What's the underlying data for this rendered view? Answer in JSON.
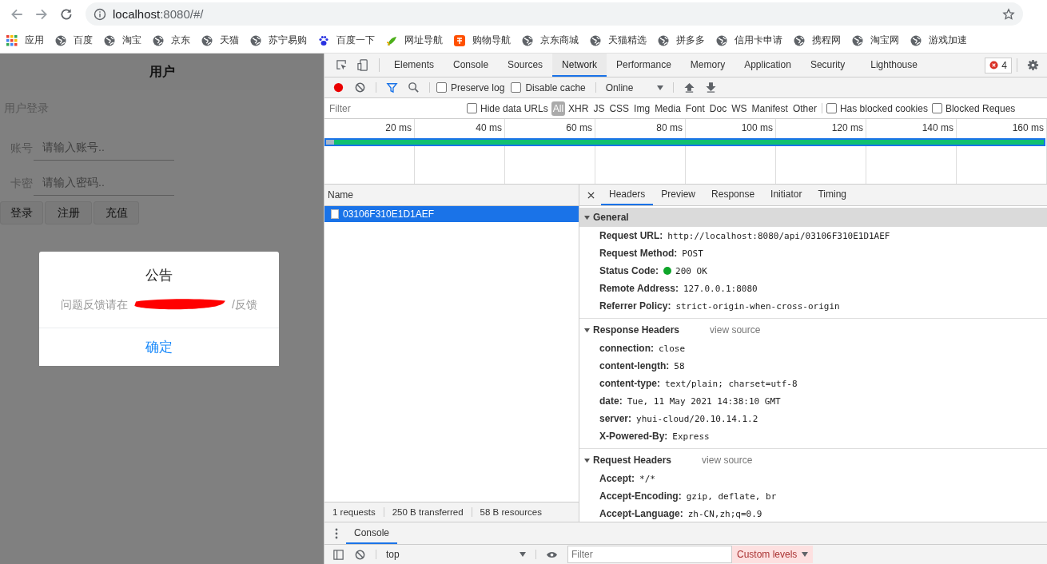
{
  "browser": {
    "url_host": "localhost",
    "url_rest": ":8080/#/"
  },
  "bookmarks": [
    {
      "label": "应用",
      "kind": "apps"
    },
    {
      "label": "百度",
      "kind": "globe"
    },
    {
      "label": "淘宝",
      "kind": "globe"
    },
    {
      "label": "京东",
      "kind": "globe"
    },
    {
      "label": "天猫",
      "kind": "globe"
    },
    {
      "label": "苏宁易购",
      "kind": "globe"
    },
    {
      "label": "百度一下",
      "kind": "paw"
    },
    {
      "label": "网址导航",
      "kind": "leaf"
    },
    {
      "label": "购物导航",
      "kind": "tao"
    },
    {
      "label": "京东商城",
      "kind": "globe"
    },
    {
      "label": "天猫精选",
      "kind": "globe"
    },
    {
      "label": "拼多多",
      "kind": "globe"
    },
    {
      "label": "信用卡申请",
      "kind": "globe"
    },
    {
      "label": "携程网",
      "kind": "globe"
    },
    {
      "label": "淘宝网",
      "kind": "globe"
    },
    {
      "label": "游戏加速",
      "kind": "globe"
    }
  ],
  "page": {
    "header": "用户",
    "section_title": "用户登录",
    "fields": [
      {
        "label": "账号",
        "placeholder": "请输入账号.."
      },
      {
        "label": "卡密",
        "placeholder": "请输入密码.."
      }
    ],
    "buttons": [
      "登录",
      "注册",
      "充值"
    ]
  },
  "dialog": {
    "title": "公告",
    "message_start": "问题反馈请在",
    "message_end": "/反馈",
    "confirm": "确定"
  },
  "devtools": {
    "tabs": [
      {
        "label": "Elements",
        "selected": false
      },
      {
        "label": "Console",
        "selected": false
      },
      {
        "label": "Sources",
        "selected": false
      },
      {
        "label": "Network",
        "selected": true
      },
      {
        "label": "Performance",
        "selected": false
      },
      {
        "label": "Memory",
        "selected": false
      },
      {
        "label": "Application",
        "selected": false
      },
      {
        "label": "Security",
        "selected": false
      },
      {
        "label": "Lighthouse",
        "selected": false
      }
    ],
    "error_count": "4",
    "toolbar": {
      "recording": true,
      "options": [
        {
          "label": "Preserve log",
          "checked": false
        },
        {
          "label": "Disable cache",
          "checked": false
        }
      ],
      "throttle": "Online"
    },
    "filter": {
      "placeholder": "Filter",
      "hide_data_urls": {
        "label": "Hide data URLs",
        "checked": false
      },
      "types": [
        {
          "label": "All",
          "selected": true
        },
        {
          "label": "XHR",
          "selected": false
        },
        {
          "label": "JS",
          "selected": false
        },
        {
          "label": "CSS",
          "selected": false
        },
        {
          "label": "Img",
          "selected": false
        },
        {
          "label": "Media",
          "selected": false
        },
        {
          "label": "Font",
          "selected": false
        },
        {
          "label": "Doc",
          "selected": false
        },
        {
          "label": "WS",
          "selected": false
        },
        {
          "label": "Manifest",
          "selected": false
        },
        {
          "label": "Other",
          "selected": false
        }
      ],
      "extra": [
        {
          "label": "Has blocked cookies",
          "checked": false
        },
        {
          "label": "Blocked Reques",
          "checked": false
        }
      ]
    },
    "timeline": {
      "ticks": [
        "20 ms",
        "40 ms",
        "60 ms",
        "80 ms",
        "100 ms",
        "120 ms",
        "140 ms",
        "160 ms"
      ]
    },
    "requests": {
      "column": "Name",
      "rows": [
        {
          "name": "03106F310E1D1AEF",
          "selected": true
        }
      ],
      "summary": [
        "1 requests",
        "250 B transferred",
        "58 B resources"
      ]
    },
    "detail_tabs": [
      {
        "label": "Headers",
        "selected": true
      },
      {
        "label": "Preview",
        "selected": false
      },
      {
        "label": "Response",
        "selected": false
      },
      {
        "label": "Initiator",
        "selected": false
      },
      {
        "label": "Timing",
        "selected": false
      }
    ],
    "sections": [
      {
        "title": "General",
        "expanded": true,
        "focused": true,
        "rows": [
          {
            "key": "Request URL:",
            "value": "http://localhost:8080/api/03106F310E1D1AEF",
            "kind": "plain"
          },
          {
            "key": "Request Method:",
            "value": "POST",
            "kind": "plain"
          },
          {
            "key": "Status Code:",
            "value": "200 OK",
            "kind": "status"
          },
          {
            "key": "Remote Address:",
            "value": "127.0.0.1:8080",
            "kind": "plain"
          },
          {
            "key": "Referrer Policy:",
            "value": "strict-origin-when-cross-origin",
            "kind": "plain"
          }
        ]
      },
      {
        "title": "Response Headers",
        "view_source": "view source",
        "expanded": true,
        "focused": false,
        "rows": [
          {
            "key": "connection:",
            "value": "close",
            "kind": "plain"
          },
          {
            "key": "content-length:",
            "value": "58",
            "kind": "plain"
          },
          {
            "key": "content-type:",
            "value": "text/plain; charset=utf-8",
            "kind": "plain"
          },
          {
            "key": "date:",
            "value": "Tue, 11 May 2021 14:38:10 GMT",
            "kind": "plain"
          },
          {
            "key": "server:",
            "value": "yhui-cloud/20.10.14.1.2",
            "kind": "plain"
          },
          {
            "key": "X-Powered-By:",
            "value": "Express",
            "kind": "plain"
          }
        ]
      },
      {
        "title": "Request Headers",
        "view_source": "view source",
        "expanded": true,
        "focused": false,
        "rows": [
          {
            "key": "Accept:",
            "value": "*/*",
            "kind": "plain"
          },
          {
            "key": "Accept-Encoding:",
            "value": "gzip, deflate, br",
            "kind": "plain"
          },
          {
            "key": "Accept-Language:",
            "value": "zh-CN,zh;q=0.9",
            "kind": "plain"
          }
        ]
      }
    ],
    "drawer": {
      "tab": "Console",
      "context": "top",
      "filter_placeholder": "Filter",
      "levels": "Custom levels"
    }
  }
}
